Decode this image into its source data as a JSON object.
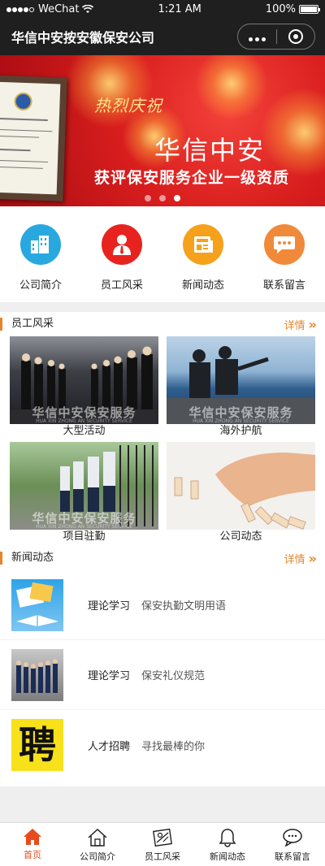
{
  "status_bar": {
    "carrier": "WeChat",
    "time": "1:21 AM",
    "battery": "100%"
  },
  "navbar": {
    "title": "华信中安按安徽保安公司"
  },
  "banner": {
    "headline_small": "热烈庆祝",
    "headline_big": "华信中安",
    "subline": "获评保安服务企业一级资质",
    "slide_count": 3,
    "active_slide": 3
  },
  "quick_menu": [
    {
      "label": "公司简介",
      "icon": "building-icon",
      "color": "#29a8e0"
    },
    {
      "label": "员工风采",
      "icon": "person-icon",
      "color": "#e8231f"
    },
    {
      "label": "新闻动态",
      "icon": "newspaper-icon",
      "color": "#f5a11b"
    },
    {
      "label": "联系留言",
      "icon": "chat-icon",
      "color": "#f08a3a"
    }
  ],
  "staff_section": {
    "title": "员工风采",
    "more": "详情",
    "items": [
      {
        "caption": "大型活动"
      },
      {
        "caption": "海外护航"
      },
      {
        "caption": "项目驻勤"
      },
      {
        "caption": "公司动态"
      }
    ],
    "watermark": "华信中安保安服务",
    "watermark_en": "HUA XIN ZHONG AN SECURITY SERVICE"
  },
  "news_section": {
    "title": "新闻动态",
    "more": "详情",
    "items": [
      {
        "category": "理论学习",
        "desc": "保安执勤文明用语"
      },
      {
        "category": "理论学习",
        "desc": "保安礼仪规范"
      },
      {
        "category": "人才招聘",
        "desc": "寻找最棒的你",
        "thumb_char": "聘"
      }
    ]
  },
  "tabbar": [
    {
      "label": "首页",
      "icon": "home-icon",
      "active": true
    },
    {
      "label": "公司简介",
      "icon": "house-outline-icon",
      "active": false
    },
    {
      "label": "员工风采",
      "icon": "staff-icon",
      "active": false
    },
    {
      "label": "新闻动态",
      "icon": "bell-icon",
      "active": false
    },
    {
      "label": "联系留言",
      "icon": "chat-bubble-icon",
      "active": false
    }
  ],
  "colors": {
    "accent": "#e8852a",
    "active_tab": "#e84a1d",
    "nav_bg": "#1f1f1f"
  }
}
